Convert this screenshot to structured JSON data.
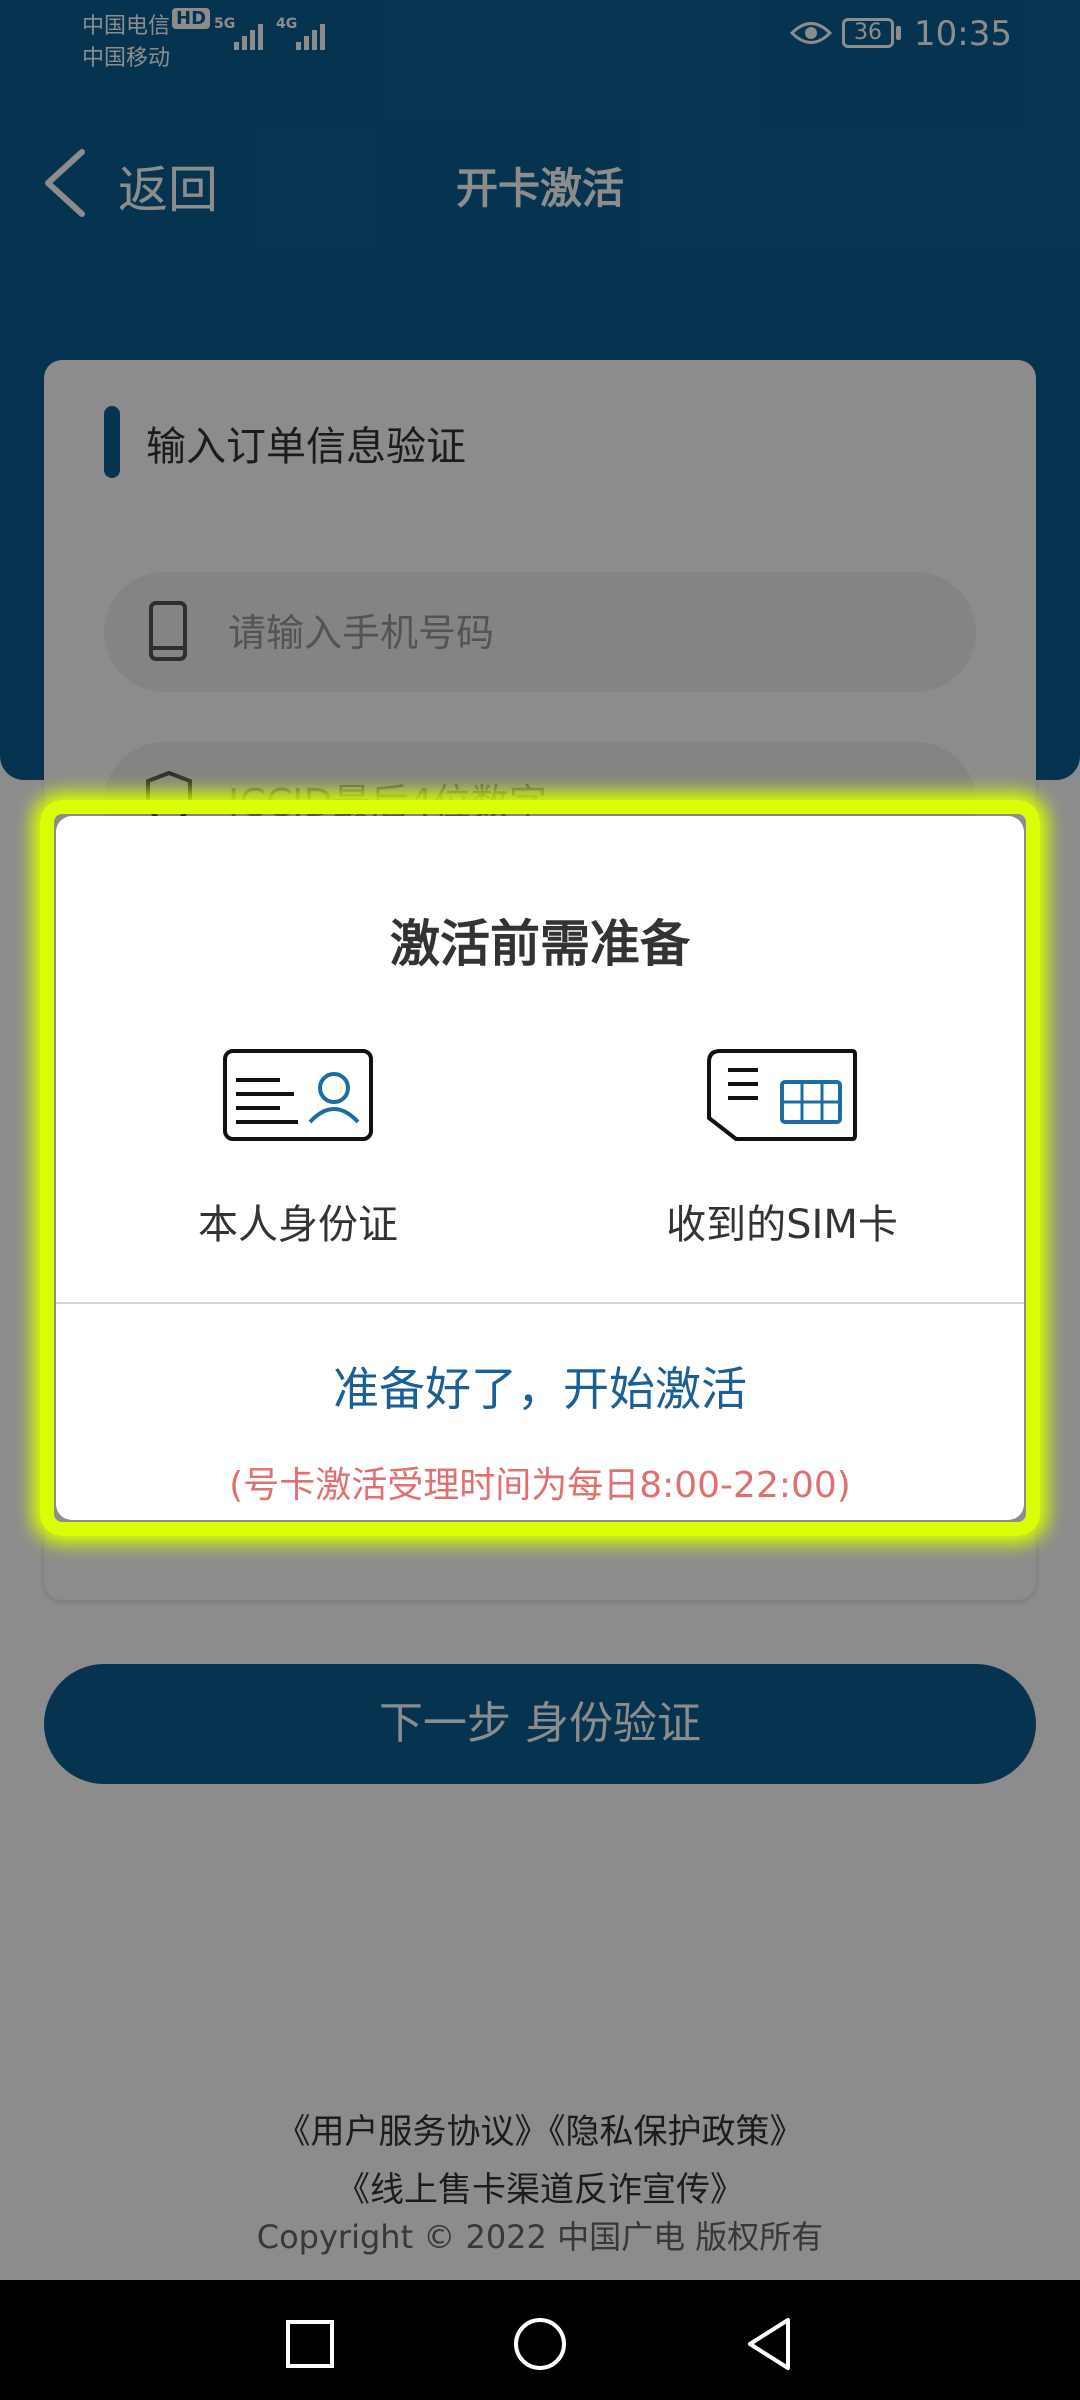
{
  "status_bar": {
    "carrier_1": "中国电信",
    "carrier_2": "中国移动",
    "hd_badge": "HD",
    "net_1": "5G",
    "net_2": "4G",
    "battery": "36",
    "time": "10:35"
  },
  "header": {
    "back_label": "返回",
    "title": "开卡激活"
  },
  "form": {
    "section_title": "输入订单信息验证",
    "phone_placeholder": "请输入手机号码",
    "iccid_placeholder": "ICCID最后4位数字",
    "next_button": "下一步 身份验证"
  },
  "footer": {
    "link_user_agreement": "《用户服务协议》",
    "link_privacy": "《隐私保护政策》",
    "link_anti_fraud": "《线上售卡渠道反诈宣传》",
    "copyright": "Copyright © 2022 中国广电 版权所有"
  },
  "modal": {
    "title": "激活前需准备",
    "item_id_card": "本人身份证",
    "item_sim": "收到的SIM卡",
    "start_button": "准备好了，开始激活",
    "notice": "(号卡激活受理时间为每日8:00-22:00)"
  },
  "colors": {
    "brand": "#0b5f93",
    "modal_highlight": "#d9ff00",
    "notice": "#e07070",
    "link_blue": "#1a5f96"
  },
  "icons": [
    "back-chevron-icon",
    "phone-icon",
    "shield-icon",
    "id-card-icon",
    "sim-card-icon",
    "eye-icon",
    "battery-icon",
    "recent-apps-icon",
    "home-icon",
    "back-triangle-icon"
  ]
}
